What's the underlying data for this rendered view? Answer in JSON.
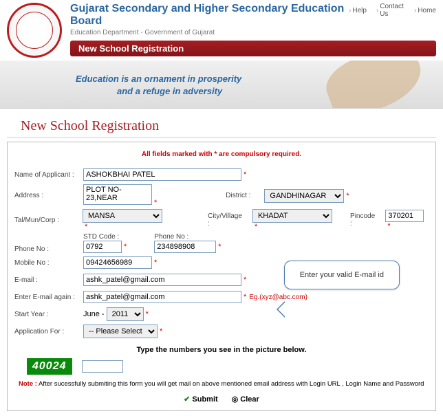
{
  "header": {
    "title": "Gujarat Secondary and Higher Secondary Education Board",
    "subtitle": "Education Department - Government of Gujarat",
    "ribbon": "New School Registration",
    "links": {
      "help": "Help",
      "contact": "Contact Us",
      "home": "Home"
    }
  },
  "banner": {
    "line1": "Education is an ornament in prosperity",
    "line2": "and a refuge in adversity"
  },
  "page_title": "New School Registration",
  "required_note": "All fields marked with * are compulsory required.",
  "labels": {
    "applicant": "Name of Applicant :",
    "address": "Address :",
    "district": "District :",
    "talmuncorp": "Tal/Mun/Corp :",
    "cityvillage": "City/Village :",
    "pincode": "Pincode :",
    "phone": "Phone No :",
    "stdcode": "STD Code :",
    "phoneno": "Phone No :",
    "mobile": "Mobile No :",
    "email": "E-mail :",
    "email2": "Enter E-mail again :",
    "startyear": "Start Year :",
    "appfor": "Application For :"
  },
  "values": {
    "applicant": "ASHOKBHAI PATEL",
    "address": "PLOT NO-23,NEAR",
    "district": "GANDHINAGAR",
    "talmuncorp": "MANSA",
    "cityvillage": "KHADAT",
    "pincode": "370201",
    "stdcode": "0792",
    "phoneno": "234898908",
    "mobile": "09424656989",
    "email": "ashk_patel@gmail.com",
    "email2": "ashk_patel@gmail.com",
    "startmonth": "June",
    "startyear": "2011",
    "appfor": "-- Please Select --"
  },
  "email_hint": "Eg.(xyz@abc.com)",
  "tooltip": "Enter your valid E-mail id",
  "captcha_label": "Type the numbers you see in the picture below.",
  "captcha": "40024",
  "note_prefix": "Note :",
  "note_text": " After sucessfully submiting this form you will get mail on above mentioned email address with Login URL , Login Name and Password",
  "buttons": {
    "submit": "Submit",
    "clear": "Clear"
  }
}
